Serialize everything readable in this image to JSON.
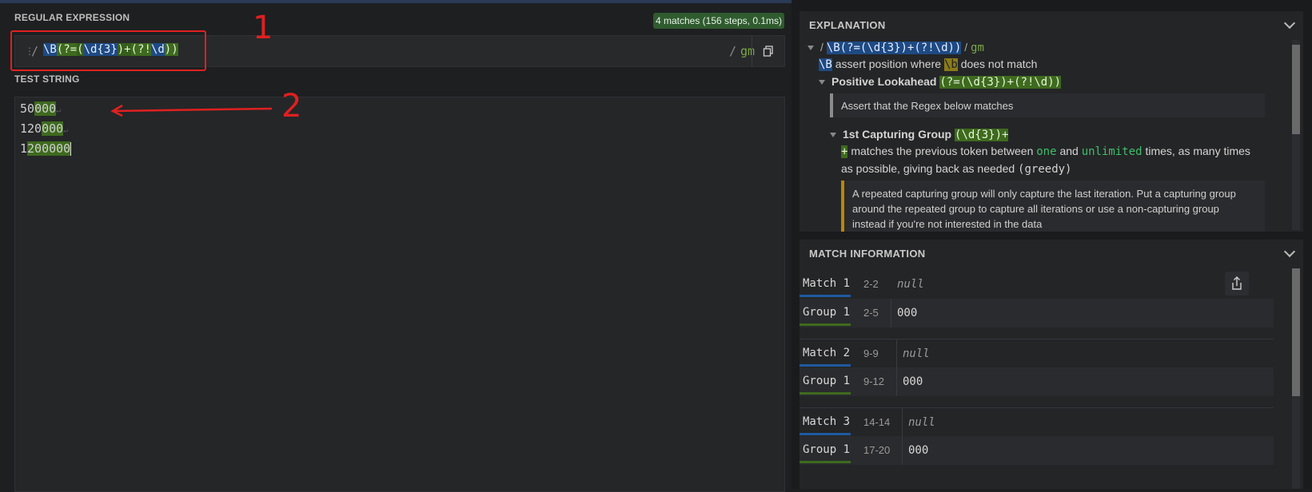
{
  "regex_panel": {
    "title": "REGULAR EXPRESSION",
    "match_badge": "4 matches (156 steps, 0.1ms)",
    "regex_tokens": [
      {
        "text": "\\B",
        "style": "blue"
      },
      {
        "text": "(?=",
        "style": "green"
      },
      {
        "text": "(",
        "style": "g2"
      },
      {
        "text": "\\d{3}",
        "style": "blue"
      },
      {
        "text": ")+",
        "style": "g2"
      },
      {
        "text": "(?!",
        "style": "green"
      },
      {
        "text": "\\d",
        "style": "blue"
      },
      {
        "text": "))",
        "style": "green"
      }
    ],
    "open_delimiter": "/",
    "close_delimiter": "/",
    "flags": "gm"
  },
  "test_panel": {
    "title": "TEST STRING",
    "lines": [
      {
        "pre": "50",
        "hl": "000",
        "nl": true
      },
      {
        "pre": "120",
        "hl": "000",
        "nl": true
      },
      {
        "pre": "1",
        "hl": "200000",
        "nl": false
      }
    ]
  },
  "annotations": {
    "label_1": "1",
    "label_2": "2"
  },
  "explanation": {
    "title": "EXPLANATION",
    "top_line_regex": "\\B(?=(\\d{3})+(?!\\d))",
    "top_line_flags": "gm",
    "line_b_token": "\\B",
    "line_b_text_1": "assert position where",
    "line_b_token2": "\\b",
    "line_b_text_2": "does not match",
    "lookahead_label": "Positive Lookahead",
    "lookahead_token": "(?=(\\d{3})+(?!\\d))",
    "note_1": "Assert that the Regex below matches",
    "group_label": "1st Capturing Group",
    "group_token": "(\\d{3})+",
    "plus_token": "+",
    "plus_text_1": "matches the previous token between",
    "plus_kw_1": "one",
    "plus_text_2": "and",
    "plus_kw_2": "unlimited",
    "plus_text_3": "times, as many times",
    "plus_line_2": "as possible, giving back as needed",
    "plus_line_2_code": "(greedy)",
    "warning_1": "A repeated capturing group will only capture the last iteration. Put a capturing group",
    "warning_2": "around the repeated group to capture all iterations or use a non-capturing group",
    "warning_3": "instead if you're not interested in the data"
  },
  "match_info": {
    "title": "MATCH INFORMATION",
    "rows": [
      {
        "label": "Match 1",
        "range": "2-2",
        "value": "null",
        "kind": "match"
      },
      {
        "label": "Group 1",
        "range": "2-5",
        "value": "000",
        "kind": "group"
      },
      {
        "label": "Match 2",
        "range": "9-9",
        "value": "null",
        "kind": "match"
      },
      {
        "label": "Group 1",
        "range": "9-12",
        "value": "000",
        "kind": "group"
      },
      {
        "label": "Match 3",
        "range": "14-14",
        "value": "null",
        "kind": "match"
      },
      {
        "label": "Group 1",
        "range": "17-20",
        "value": "000",
        "kind": "group"
      }
    ]
  },
  "colors": {
    "match_blue": "#1e5aa0",
    "group_green": "#3e6a1e",
    "annotation_red": "#e02020",
    "warning_amber": "#b8860b"
  }
}
